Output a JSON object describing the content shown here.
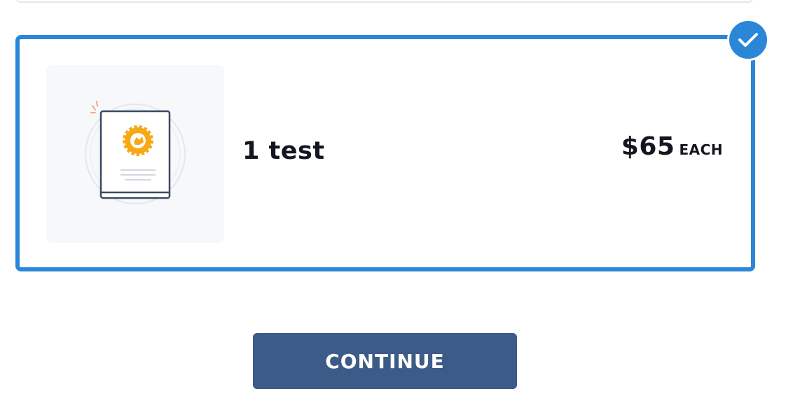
{
  "option": {
    "label": "1 test",
    "price": "$65",
    "price_unit": "EACH",
    "selected": true,
    "icon": "certificate-booklet-icon"
  },
  "actions": {
    "continue_label": "CONTINUE"
  },
  "colors": {
    "selected_border": "#2a87d8",
    "check_badge": "#2a87d8",
    "button_bg": "#3c5b88",
    "text": "#14161f",
    "icon_accent": "#f5a623"
  }
}
